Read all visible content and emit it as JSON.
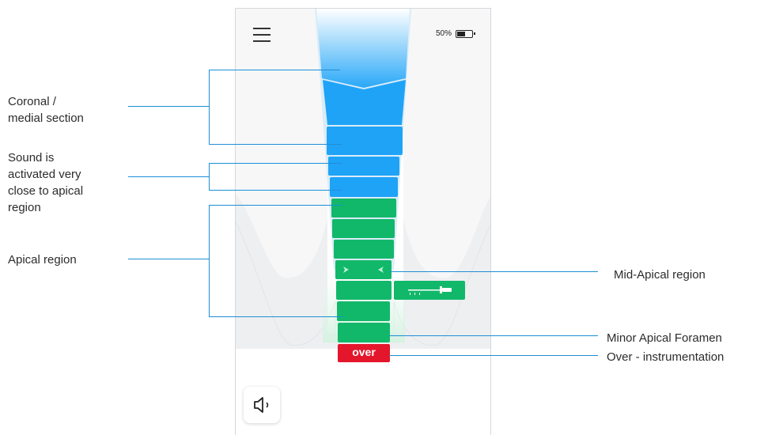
{
  "status": {
    "battery": "50%"
  },
  "over_label": "over",
  "colors": {
    "blue": "#1fa3f7",
    "green": "#12b86a",
    "red": "#e3162c",
    "line": "#1d8fd6"
  },
  "icons": [
    "menu-icon",
    "battery-icon",
    "speaker-icon",
    "arrow-right-icon",
    "arrow-left-icon",
    "file-instrument-icon"
  ],
  "callouts": {
    "coronal": [
      "Coronal /",
      "medial section"
    ],
    "sound": [
      "Sound is",
      "activated very",
      "close to apical",
      "region"
    ],
    "apical": [
      "Apical region"
    ],
    "mid_apical": "Mid-Apical region",
    "minor_foramen": "Minor Apical Foramen",
    "over_instrumentation": "Over - instrumentation"
  }
}
